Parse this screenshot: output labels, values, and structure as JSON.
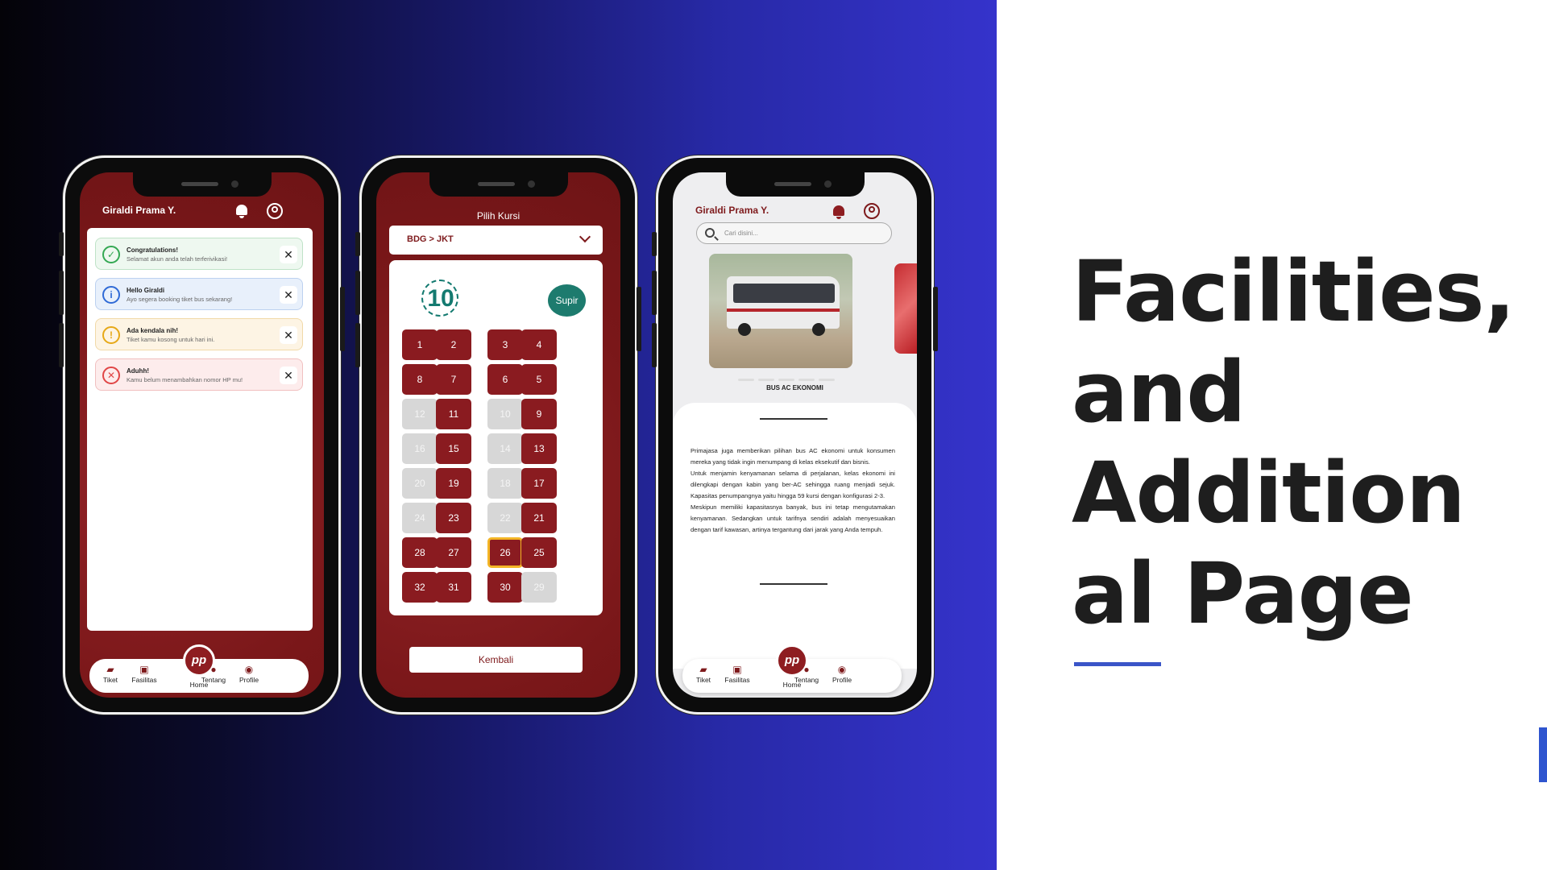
{
  "slide": {
    "headline_lines": [
      "Facilities,",
      "and",
      "Addition",
      "al Page"
    ],
    "accent_color": "#3a55c8"
  },
  "nav": {
    "items": [
      "Tiket",
      "Fasilitas",
      "Home",
      "Tentang",
      "Profile"
    ],
    "home_logo": "pp"
  },
  "phone1": {
    "user_name": "Giraldi Prama Y.",
    "notifications": [
      {
        "title": "Congratulations!",
        "text": "Selamat akun anda telah terferivikasi!",
        "type": "success",
        "icon": "check-icon"
      },
      {
        "title": "Hello Giraldi",
        "text": "Ayo segera booking tiket bus sekarang!",
        "type": "info",
        "icon": "info-icon"
      },
      {
        "title": "Ada kendala nih!",
        "text": "Tiket kamu kosong untuk hari ini.",
        "type": "warning",
        "icon": "warning-icon"
      },
      {
        "title": "Aduhh!",
        "text": "Kamu belum menambahkan nomor HP mu!",
        "type": "error",
        "icon": "error-icon"
      }
    ]
  },
  "phone2": {
    "title": "Pilih Kursi",
    "route": "BDG > JKT",
    "driver_label": "Supir",
    "wheel_label": "10",
    "back_label": "Kembali",
    "seat_rows": [
      [
        {
          "n": "1",
          "s": "a"
        },
        {
          "n": "2",
          "s": "a"
        },
        {
          "n": "3",
          "s": "a"
        },
        {
          "n": "4",
          "s": "a"
        }
      ],
      [
        {
          "n": "8",
          "s": "a"
        },
        {
          "n": "7",
          "s": "a"
        },
        {
          "n": "6",
          "s": "a"
        },
        {
          "n": "5",
          "s": "a"
        }
      ],
      [
        {
          "n": "12",
          "s": "o"
        },
        {
          "n": "11",
          "s": "a"
        },
        {
          "n": "10",
          "s": "o"
        },
        {
          "n": "9",
          "s": "a"
        }
      ],
      [
        {
          "n": "16",
          "s": "o"
        },
        {
          "n": "15",
          "s": "a"
        },
        {
          "n": "14",
          "s": "o"
        },
        {
          "n": "13",
          "s": "a"
        }
      ],
      [
        {
          "n": "20",
          "s": "o"
        },
        {
          "n": "19",
          "s": "a"
        },
        {
          "n": "18",
          "s": "o"
        },
        {
          "n": "17",
          "s": "a"
        }
      ],
      [
        {
          "n": "24",
          "s": "o"
        },
        {
          "n": "23",
          "s": "a"
        },
        {
          "n": "22",
          "s": "o"
        },
        {
          "n": "21",
          "s": "a"
        }
      ],
      [
        {
          "n": "28",
          "s": "a"
        },
        {
          "n": "27",
          "s": "a"
        },
        {
          "n": "26",
          "s": "sel"
        },
        {
          "n": "25",
          "s": "a"
        }
      ],
      [
        {
          "n": "32",
          "s": "a"
        },
        {
          "n": "31",
          "s": "a"
        },
        {
          "n": "30",
          "s": "a"
        },
        {
          "n": "29",
          "s": "o"
        }
      ]
    ]
  },
  "phone3": {
    "user_name": "Giraldi Prama Y.",
    "search_placeholder": "Cari disini...",
    "bus_label": "BUS AC EKONOMI",
    "description": [
      "Primajasa juga memberikan pilihan bus AC ekonomi untuk konsumen mereka yang tidak ingin menumpang di kelas eksekutif dan bisnis.",
      "Untuk menjamin kenyamanan selama di perjalanan, kelas ekonomi ini dilengkapi dengan kabin yang ber-AC sehingga ruang menjadi sejuk. Kapasitas penumpangnya yaitu hingga 59 kursi dengan konfigurasi 2-3.",
      "Meskipun memiliki kapasitasnya banyak, bus ini tetap mengutamakan kenyamanan. Sedangkan untuk tarifnya sendiri adalah menyesuaikan dengan tarif kawasan, artinya tergantung dari jarak yang Anda tempuh."
    ]
  }
}
